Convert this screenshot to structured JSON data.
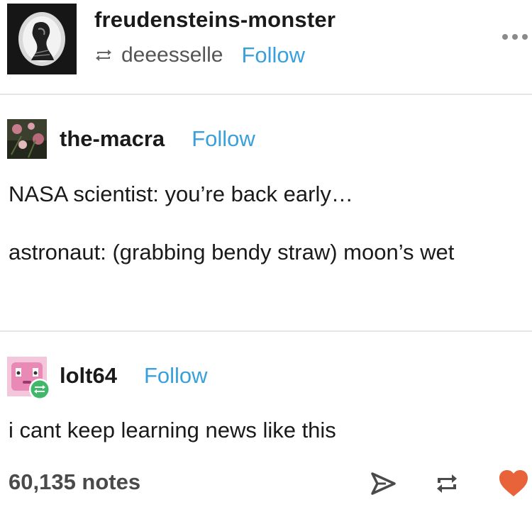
{
  "header": {
    "blog_name": "freudensteins-monster",
    "reblog_icon": "reblog-icon",
    "reblogged_from": "deeesselle",
    "follow_label": "Follow",
    "more_icon": "more-dots-icon"
  },
  "posts": [
    {
      "username": "the-macra",
      "follow_label": "Follow",
      "paragraphs": [
        "NASA scientist: you’re back early…",
        "astronaut: (grabbing bendy straw) moon’s wet"
      ]
    },
    {
      "username": "lolt64",
      "follow_label": "Follow",
      "badge_icon": "reblog-badge-icon",
      "paragraphs": [
        "i cant keep learning news like this"
      ]
    }
  ],
  "footer": {
    "notes": "60,135 notes",
    "actions": [
      "share-icon",
      "reblog-icon",
      "like-heart-icon"
    ]
  },
  "colors": {
    "follow": "#3aa0dc",
    "heart": "#e8633a",
    "badge": "#3fb86a"
  }
}
